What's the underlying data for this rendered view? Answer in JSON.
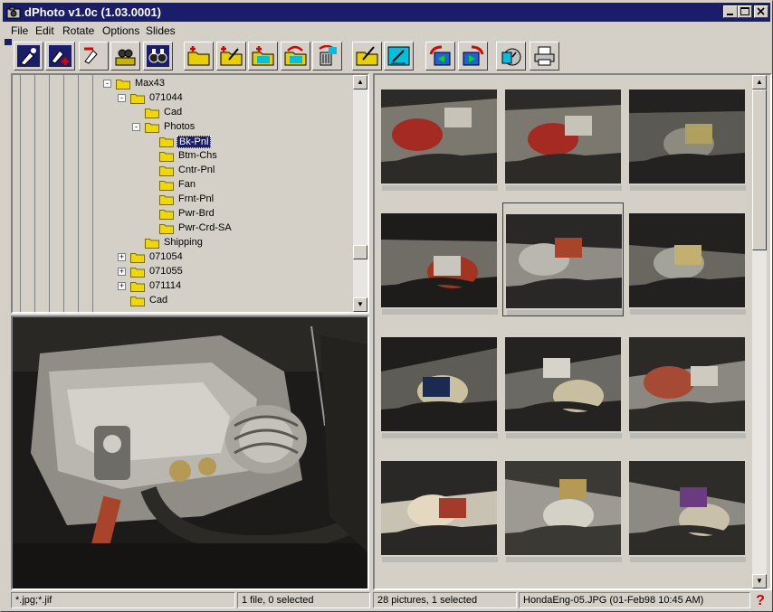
{
  "window": {
    "title": "dPhoto v1.0c (1.03.0001)"
  },
  "menu": [
    "File",
    "Edit",
    "Rotate",
    "Options",
    "Slides"
  ],
  "toolbar": {
    "buttons": [
      "pick-icon",
      "pick-add-icon",
      "unpick-icon",
      "find-icon",
      "view-binoculars-icon",
      "new-folder-icon",
      "edit-folder-icon",
      "add-folder-icon",
      "move-folder-icon",
      "trash-icon",
      "edit-picture-icon",
      "draw-picture-icon",
      "slideshow-back-icon",
      "slideshow-forward-icon",
      "timer-icon",
      "printer-icon"
    ]
  },
  "tree": {
    "items": [
      {
        "label": "Max43",
        "level": 0,
        "expander": "-"
      },
      {
        "label": "071044",
        "level": 1,
        "expander": "-"
      },
      {
        "label": "Cad",
        "level": 2,
        "expander": ""
      },
      {
        "label": "Photos",
        "level": 2,
        "expander": "-"
      },
      {
        "label": "Bk-Pnl",
        "level": 3,
        "expander": "",
        "selected": true
      },
      {
        "label": "Btm-Chs",
        "level": 3,
        "expander": ""
      },
      {
        "label": "Cntr-Pnl",
        "level": 3,
        "expander": ""
      },
      {
        "label": "Fan",
        "level": 3,
        "expander": ""
      },
      {
        "label": "Frnt-Pnl",
        "level": 3,
        "expander": ""
      },
      {
        "label": "Pwr-Brd",
        "level": 3,
        "expander": ""
      },
      {
        "label": "Pwr-Crd-SA",
        "level": 3,
        "expander": ""
      },
      {
        "label": "Shipping",
        "level": 2,
        "expander": ""
      },
      {
        "label": "071054",
        "level": 1,
        "expander": "+"
      },
      {
        "label": "071055",
        "level": 1,
        "expander": "+"
      },
      {
        "label": "071114",
        "level": 1,
        "expander": "+"
      },
      {
        "label": "Cad",
        "level": 1,
        "expander": ""
      }
    ]
  },
  "thumbnails": {
    "count": 12,
    "selected_index": 4
  },
  "status": {
    "filter": "*.jpg;*.jif",
    "files": "1 file, 0 selected",
    "pictures": "28 pictures, 1 selected",
    "file_info": "HondaEng-05.JPG (01-Feb98 10:45 AM)"
  },
  "colors": {
    "titlebar": "#1a1e6a",
    "face": "#d4d0c8"
  }
}
